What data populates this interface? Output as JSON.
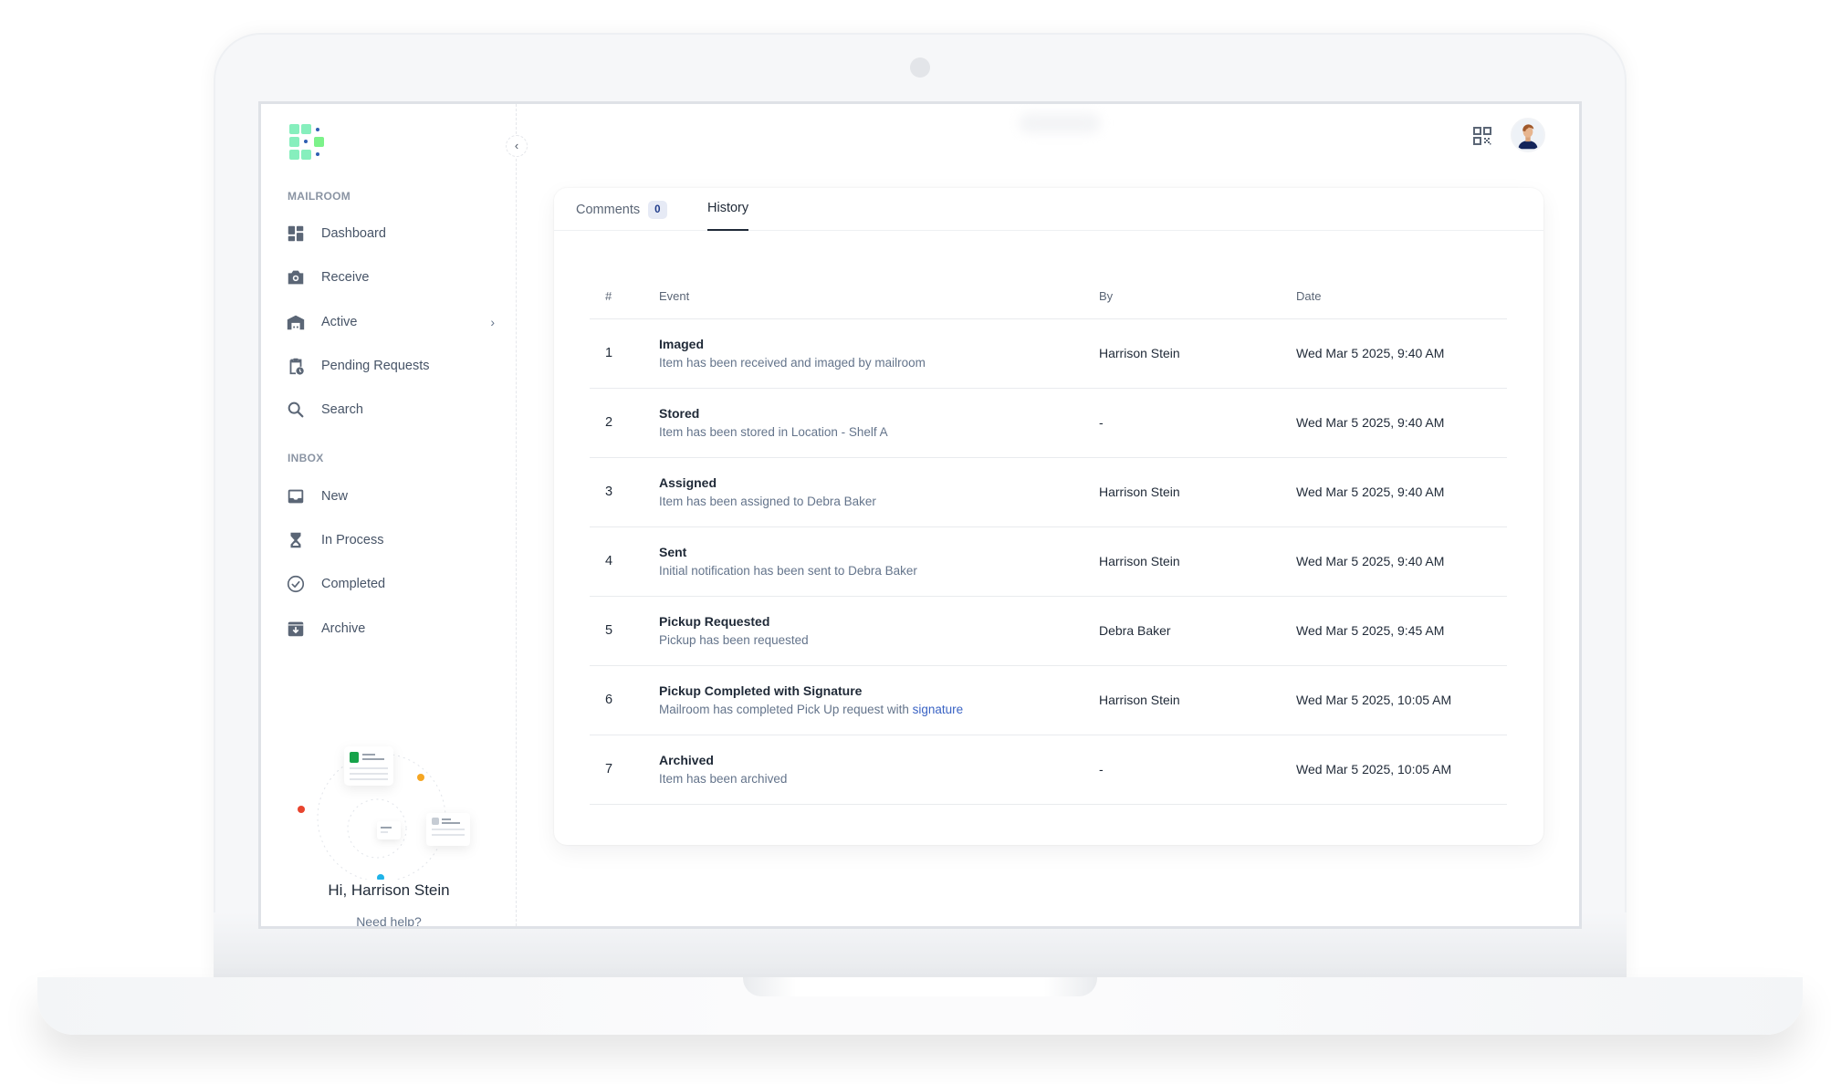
{
  "sidebar": {
    "sections": [
      {
        "label": "MAILROOM",
        "items": [
          {
            "label": "Dashboard",
            "icon": "dashboard-icon"
          },
          {
            "label": "Receive",
            "icon": "camera-icon"
          },
          {
            "label": "Active",
            "icon": "warehouse-icon",
            "has_submenu": true
          },
          {
            "label": "Pending Requests",
            "icon": "clipboard-clock-icon"
          },
          {
            "label": "Search",
            "icon": "search-icon"
          }
        ]
      },
      {
        "label": "INBOX",
        "items": [
          {
            "label": "New",
            "icon": "inbox-icon"
          },
          {
            "label": "In Process",
            "icon": "hourglass-icon"
          },
          {
            "label": "Completed",
            "icon": "check-circle-icon"
          },
          {
            "label": "Archive",
            "icon": "archive-icon"
          }
        ]
      }
    ],
    "collapse_glyph": "‹",
    "submenu_glyph": "›",
    "greeting": "Hi, Harrison Stein",
    "help_link": "Need help?"
  },
  "topbar": {
    "qr_icon": "qr-code-icon",
    "avatar_icon": "user-avatar"
  },
  "tabs": [
    {
      "label": "Comments",
      "badge": "0",
      "active": false
    },
    {
      "label": "History",
      "active": true
    }
  ],
  "history": {
    "columns": [
      "#",
      "Event",
      "By",
      "Date"
    ],
    "rows": [
      {
        "num": "1",
        "title": "Imaged",
        "desc": "Item has been received and imaged by mailroom",
        "link": "",
        "by": "Harrison Stein",
        "date": "Wed Mar 5 2025, 9:40 AM"
      },
      {
        "num": "2",
        "title": "Stored",
        "desc": "Item has been stored in Location - Shelf A",
        "link": "",
        "by": "-",
        "date": "Wed Mar 5 2025, 9:40 AM"
      },
      {
        "num": "3",
        "title": "Assigned",
        "desc": "Item has been assigned to Debra Baker",
        "link": "",
        "by": "Harrison Stein",
        "date": "Wed Mar 5 2025, 9:40 AM"
      },
      {
        "num": "4",
        "title": "Sent",
        "desc": "Initial notification has been sent to Debra Baker",
        "link": "",
        "by": "Harrison Stein",
        "date": "Wed Mar 5 2025, 9:40 AM"
      },
      {
        "num": "5",
        "title": "Pickup Requested",
        "desc": "Pickup has been requested",
        "link": "",
        "by": "Debra Baker",
        "date": "Wed Mar 5 2025, 9:45 AM"
      },
      {
        "num": "6",
        "title": "Pickup Completed with Signature",
        "desc": "Mailroom has completed Pick Up request with ",
        "link": "signature",
        "by": "Harrison Stein",
        "date": "Wed Mar 5 2025, 10:05 AM"
      },
      {
        "num": "7",
        "title": "Archived",
        "desc": "Item has been archived",
        "link": "",
        "by": "-",
        "date": "Wed Mar 5 2025, 10:05 AM"
      }
    ]
  },
  "colors": {
    "logo_green": "#86efbd",
    "logo_bright_green": "#7cf28a",
    "logo_blue": "#2f5fb3",
    "link": "#3b64c4",
    "icon_gray": "#5b6676",
    "dot_red": "#e8442e",
    "dot_orange": "#f5a623",
    "dot_blue": "#1fb3e8",
    "dot_green": "#16a34a"
  }
}
